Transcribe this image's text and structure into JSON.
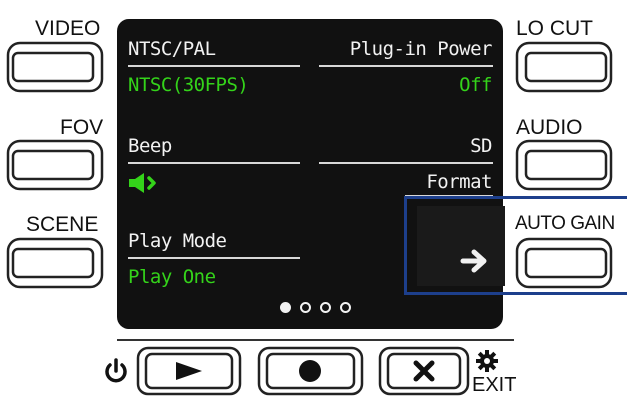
{
  "left_buttons": [
    {
      "label": "VIDEO"
    },
    {
      "label": "FOV"
    },
    {
      "label": "SCENE"
    }
  ],
  "right_buttons": [
    {
      "label": "LO CUT"
    },
    {
      "label": "AUDIO"
    },
    {
      "label": "AUTO GAIN"
    }
  ],
  "screen": {
    "items": [
      {
        "title": "NTSC/PAL",
        "value": "NTSC(30FPS)"
      },
      {
        "title": "Plug-in Power",
        "value": "Off"
      },
      {
        "title": "Beep",
        "value_icon": "speaker-icon"
      },
      {
        "title": "SD",
        "subtitle": "Format",
        "value_icon": "arrow-right-icon"
      },
      {
        "title": "Play Mode",
        "value": "Play One"
      }
    ],
    "page_indicator": {
      "current": 1,
      "total": 4
    },
    "highlight_color": "#1d3f8c",
    "value_color": "#34d31a"
  },
  "bottom_buttons": {
    "power_icon": "power-icon",
    "play_icon": "play-icon",
    "record_icon": "record-icon",
    "close_icon": "close-icon",
    "settings_icon": "gear-icon",
    "exit_label": "EXIT"
  }
}
